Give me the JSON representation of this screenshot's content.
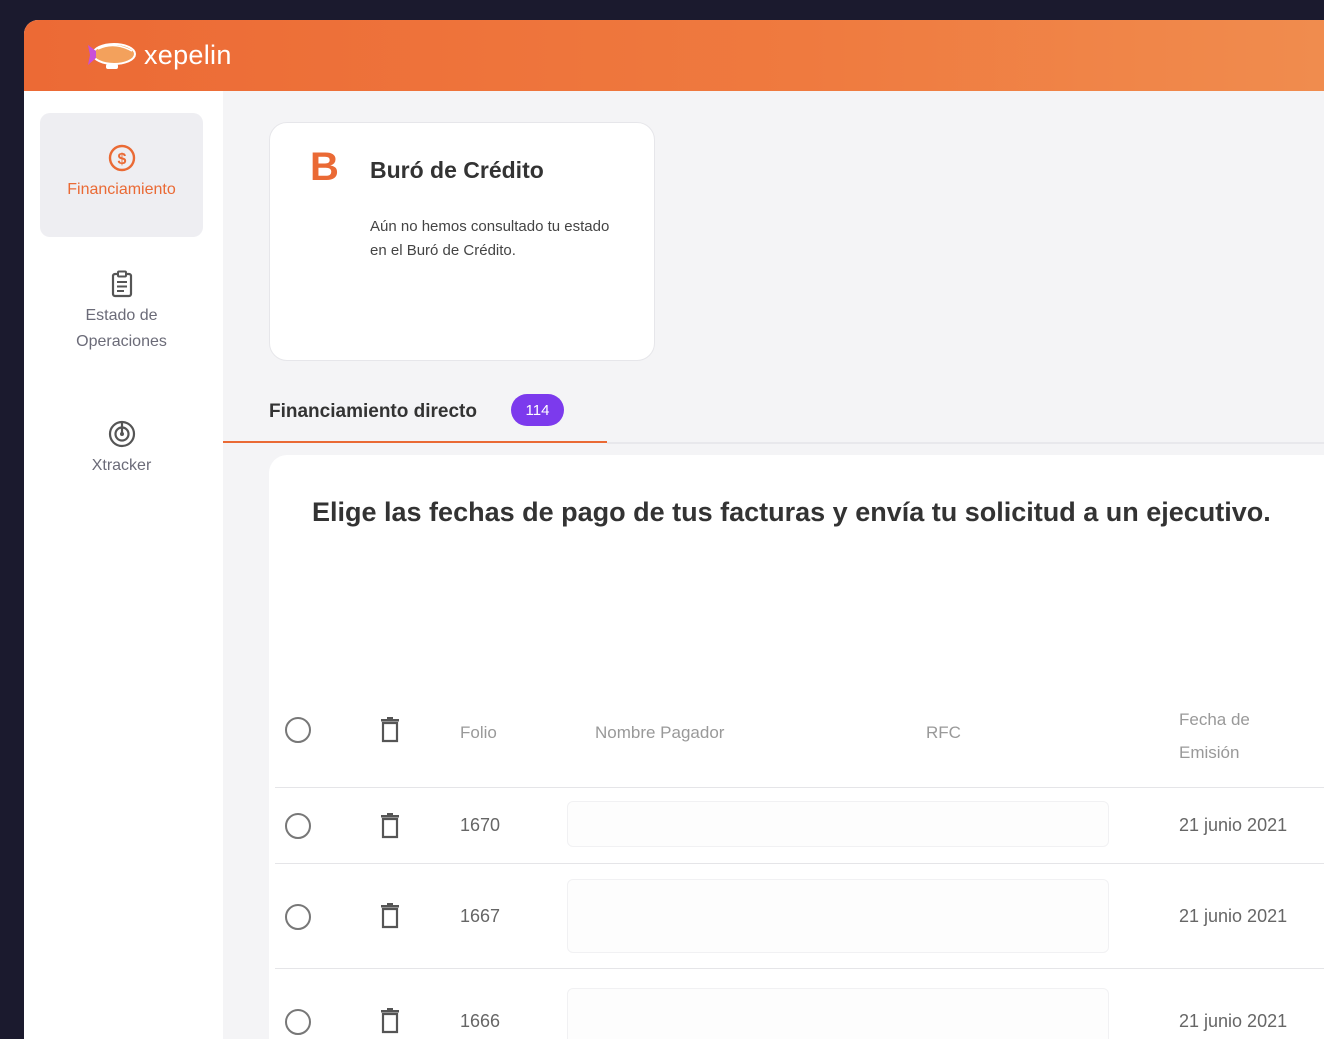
{
  "app": {
    "brand": "xepelin",
    "accent": "#ea6a35",
    "badge_color": "#7c3aed"
  },
  "sidebar": {
    "items": [
      {
        "label": "Financiamiento",
        "icon": "dollar-circle-icon",
        "active": true
      },
      {
        "label": "Estado de Operaciones",
        "icon": "clipboard-icon",
        "active": false
      },
      {
        "label": "Xtracker",
        "icon": "radar-icon",
        "active": false
      }
    ]
  },
  "credit_card": {
    "letter": "B",
    "title": "Buró de Crédito",
    "text": "Aún no hemos consultado tu estado en el Buró de Crédito."
  },
  "tab": {
    "label": "Financiamiento directo",
    "badge": "114"
  },
  "panel": {
    "heading": "Elige las fechas de pago de tus facturas y envía tu solicitud a un ejecutivo."
  },
  "table": {
    "columns": {
      "folio": "Folio",
      "nombre": "Nombre Pagador",
      "rfc": "RFC",
      "fecha": "Fecha de Emisión"
    },
    "rows": [
      {
        "folio": "1670",
        "fecha": "21 junio 2021"
      },
      {
        "folio": "1667",
        "fecha": "21 junio 2021"
      },
      {
        "folio": "1666",
        "fecha": "21 junio 2021"
      }
    ]
  }
}
